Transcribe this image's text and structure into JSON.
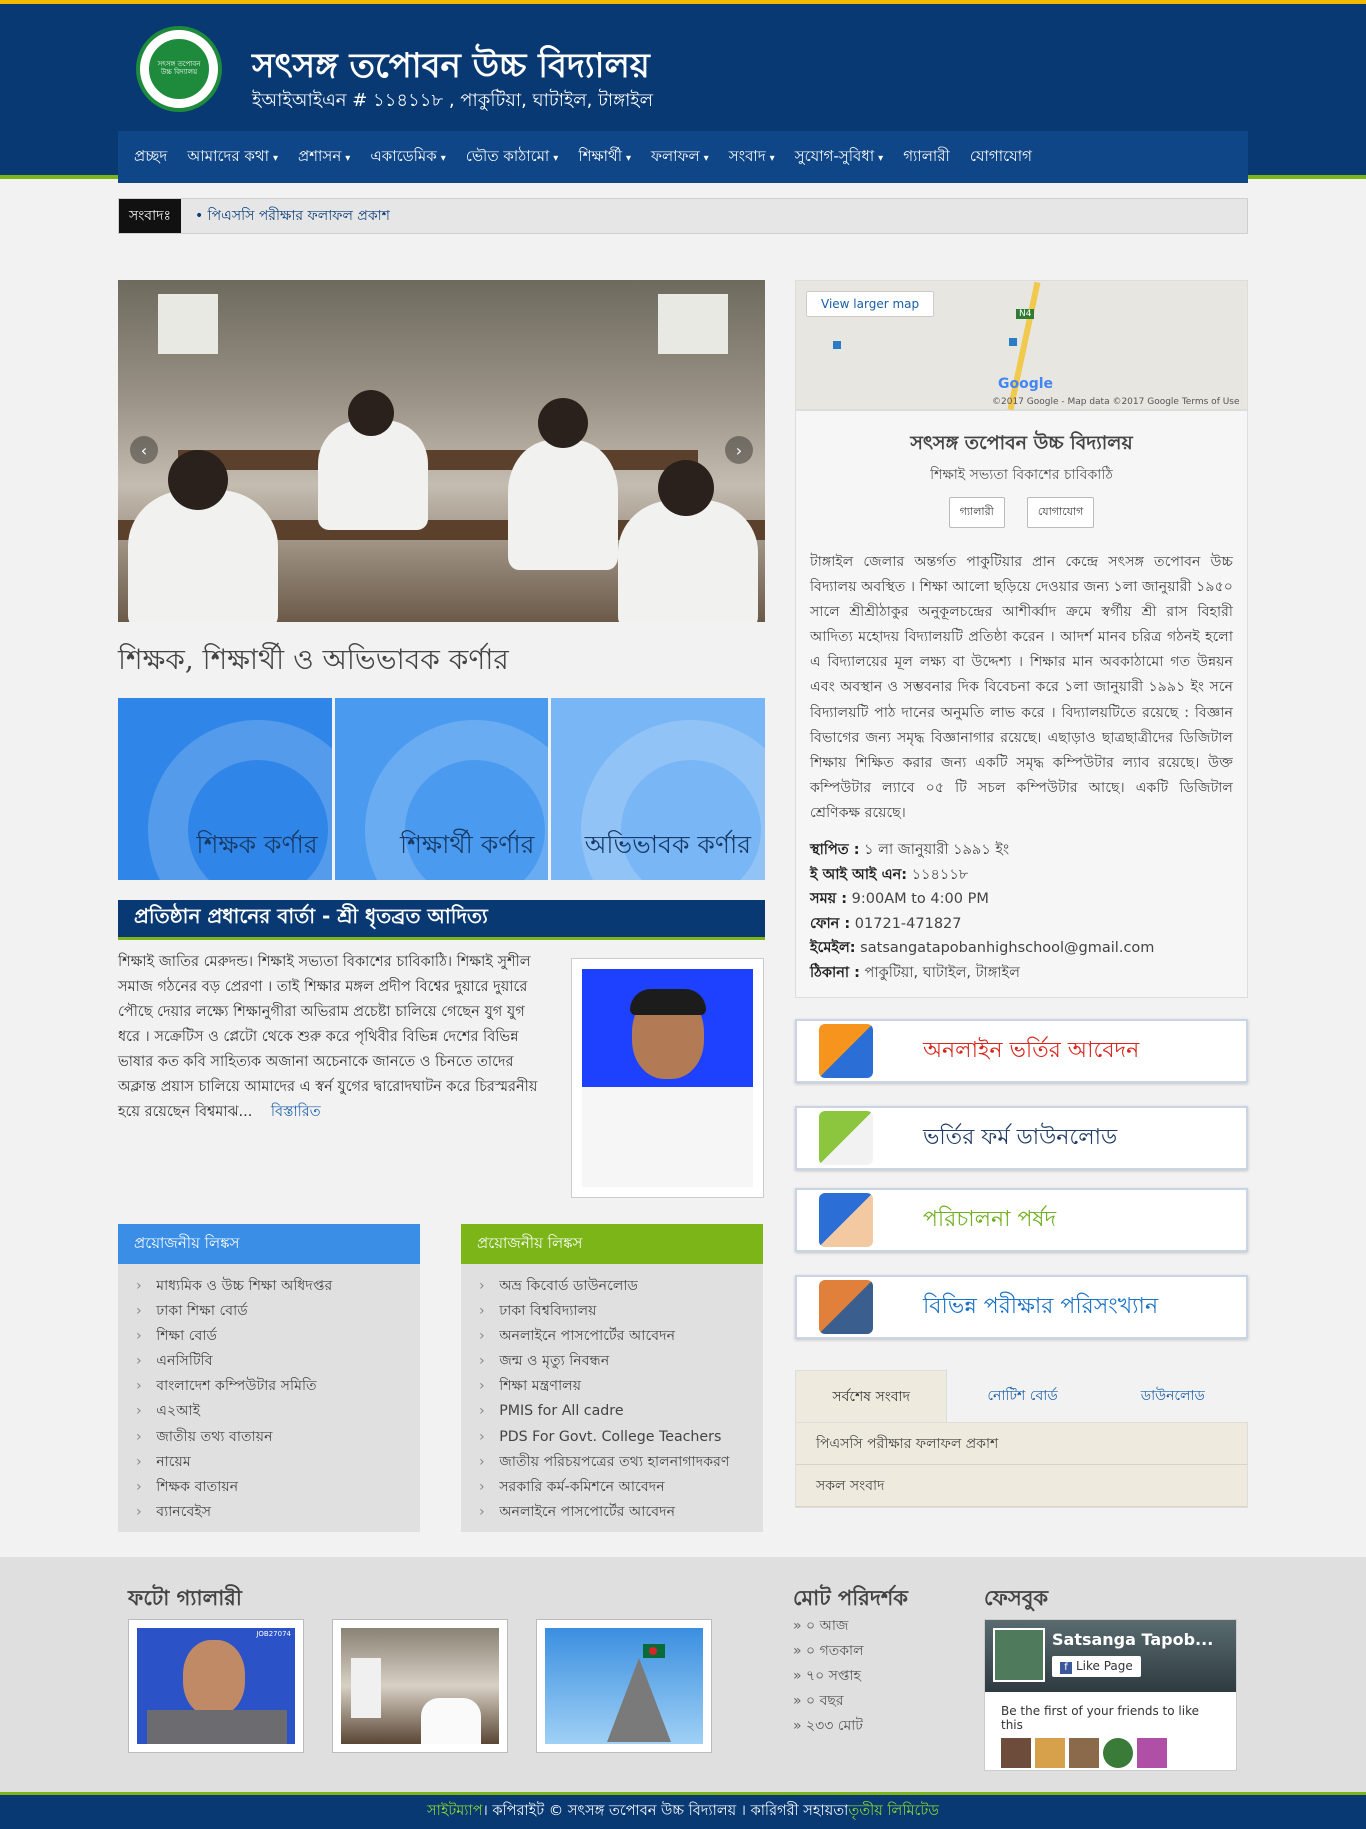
{
  "header": {
    "logo_text": "সৎসঙ্গ তপোবন উচ্চ বিদ্যালয়",
    "school_name": "সৎসঙ্গ তপোবন উচ্চ বিদ্যালয়",
    "school_sub": "ইআইআইএন # ১১৪১১৮ , পাকুটিয়া, ঘাটাইল, টাঙ্গাইল"
  },
  "nav": [
    {
      "label": "প্রচ্ছদ",
      "dropdown": false
    },
    {
      "label": "আমাদের কথা",
      "dropdown": true
    },
    {
      "label": "প্রশাসন",
      "dropdown": true
    },
    {
      "label": "একাডেমিক",
      "dropdown": true
    },
    {
      "label": "ভৌত কাঠামো",
      "dropdown": true
    },
    {
      "label": "শিক্ষার্থী",
      "dropdown": true
    },
    {
      "label": "ফলাফল",
      "dropdown": true
    },
    {
      "label": "সংবাদ",
      "dropdown": true
    },
    {
      "label": "সুযোগ-সুবিধা",
      "dropdown": true
    },
    {
      "label": "গ্যালারী",
      "dropdown": false
    },
    {
      "label": "যোগাযোগ",
      "dropdown": false
    }
  ],
  "news": {
    "label": "সংবাদঃ",
    "item": "পিএসসি পরীক্ষার ফলাফল প্রকাশ"
  },
  "corners": {
    "title": "শিক্ষক, শিক্ষার্থী ও অভিভাবক কর্ণার",
    "items": [
      {
        "label": "শিক্ষক কর্ণার",
        "color": "#2f86e8"
      },
      {
        "label": "শিক্ষার্থী কর্ণার",
        "color": "#4a9af0"
      },
      {
        "label": "অভিভাবক কর্ণার",
        "color": "#79b6f6"
      }
    ]
  },
  "head_message": {
    "title": "প্রতিষ্ঠান প্রধানের বার্তা - শ্রী ধৃতব্রত আদিত্য",
    "text": "শিক্ষাই জাতির মেরুদন্ড। শিক্ষাই সভ্যতা বিকাশের চাবিকাঠি। শিক্ষাই সুশীল সমাজ গঠনের বড় প্রেরণা । তাই শিক্ষার মঙ্গল প্রদীপ বিশ্বের দুয়ারে দুয়ারে পৌছে দেয়ার লক্ষ্যে শিক্ষানুগীরা অভিরাম প্রচেষ্টা চালিয়ে গেছেন যুগ যুগ ধরে । সক্রেটিস ও প্লেটো থেকে শুরু করে পৃথিবীর বিভিন্ন দেশের বিভিন্ন ভাষার কত কবি সাহিত্যক অজানা অচেনাকে জানতে ও চিনতে তাদের অক্লান্ত প্রয়াস চালিয়ে আমাদের এ স্বর্ন যুগের দ্বারোদঘাটন করে চিরস্মরনীয় হয়ে রয়েছেন বিশ্বমাঝ...",
    "more": "বিস্তারিত"
  },
  "links_left": {
    "title": "প্রয়োজনীয় লিঙ্কস",
    "color": "#3a8ee6",
    "items": [
      "মাধ্যমিক ও উচ্চ শিক্ষা অধিদপ্তর",
      "ঢাকা শিক্ষা বোর্ড",
      "শিক্ষা বোর্ড",
      "এনসিটিবি",
      "বাংলাদেশ কম্পিউটার সমিতি",
      "এ২আই",
      "জাতীয় তথ্য বাতায়ন",
      "নায়েম",
      "শিক্ষক বাতায়ন",
      "ব্যানবেইস"
    ]
  },
  "links_right": {
    "title": "প্রয়োজনীয় লিঙ্কস",
    "color": "#7cb518",
    "items": [
      "অভ্র কিবোর্ড ডাউনলোড",
      "ঢাকা বিশ্ববিদ্যালয়",
      "অনলাইনে পাসপোর্টের আবেদন",
      "জন্ম ও মৃত্যু নিবন্ধন",
      "শিক্ষা মন্ত্রণালয়",
      "PMIS for All cadre",
      "PDS For Govt. College Teachers",
      "জাতীয় পরিচয়পত্রের তথ্য হালনাগাদকরণ",
      "সরকারি কর্ম-কমিশনে আবেদন",
      "অনলাইনে পাসপোর্টের আবেদন"
    ]
  },
  "map": {
    "button": "View larger map",
    "brand": "Google",
    "road_label": "N4",
    "copyright": "©2017 Google - Map data ©2017 Google    Terms of Use"
  },
  "infobox": {
    "name": "সৎসঙ্গ তপোবন উচ্চ বিদ্যালয়",
    "slogan": "শিক্ষাই সভ্যতা বিকাশের চাবিকাঠি",
    "btn_gallery": "গ্যালারী",
    "btn_contact": "যোগাযোগ",
    "text": "টাঙ্গাইল জেলার অন্তর্গত পাকুটিয়ার প্রান কেন্দ্রে সৎসঙ্গ তপোবন উচ্চ বিদ্যালয় অবস্থিত । শিক্ষা আলো ছড়িয়ে দেওয়ার জন্য ১লা জানুয়ারী ১৯৫০ সালে শ্রীশ্রীঠাকুর অনুকূলচন্দ্রের আশীর্ব্বাদ ক্রমে স্বর্গীয় শ্রী রাস বিহারী আদিত্য মহোদয় বিদ্যালয়টি প্রতিষ্ঠা করেন । আদর্শ মানব চরিত্র গঠনই হলো এ বিদ্যালয়ের মূল লক্ষ্য বা উদ্দেশ্য । শিক্ষার মান অবকাঠামো গত উন্নয়ন এবং অবস্থান ও সম্ভবনার দিক বিবেচনা করে ১লা জানুয়ারী ১৯৯১ ইং সনে বিদ্যালয়টি পাঠ দানের অনুমতি লাভ করে । বিদ্যালয়টিতে রয়েছে : বিজ্ঞান বিভাগের জন্য সমৃদ্ধ বিজ্ঞানাগার রয়েছে। এছাড়াও ছাত্রছাত্রীদের ডিজিটাল শিক্ষায় শিক্ষিত করার জন্য একটি সমৃদ্ধ কম্পিউটার ল্যাব রয়েছে। উক্ত কম্পিউটার ল্যাবে ০৫ টি সচল কম্পিউটার আছে। একটি ডিজিটাল শ্রেণিকক্ষ রয়েছে।",
    "facts": [
      {
        "k": "স্থাপিত :",
        "v": " ১ লা জানুয়ারী ১৯৯১ ইং"
      },
      {
        "k": "ই আই আই এন:",
        "v": " ১১৪১১৮"
      },
      {
        "k": "সময় :",
        "v": " 9:00AM to 4:00 PM"
      },
      {
        "k": "ফোন :",
        "v": " 01721-471827"
      },
      {
        "k": "ইমেইল:",
        "v": " satsangatapobanhighschool@gmail.com"
      },
      {
        "k": "ঠিকানা :",
        "v": " পাকুটিয়া, ঘাটাইল, টাঙ্গাইল"
      }
    ]
  },
  "cta": [
    {
      "label": "অনলাইন ভর্তির আবেদন",
      "color": "#d9261c"
    },
    {
      "label": "ভর্তির ফর্ম ডাউনলোড",
      "color": "#1f3b66"
    },
    {
      "label": "পরিচালনা পর্ষদ",
      "color": "#6fae1c"
    },
    {
      "label": "বিভিন্ন পরীক্ষার পরিসংখ্যান",
      "color": "#1a73c6"
    }
  ],
  "tabs": {
    "labels": [
      "সর্বশেষ সংবাদ",
      "নোটিশ বোর্ড",
      "ডাউনলোড"
    ],
    "items": [
      "পিএসসি পরীক্ষার ফলাফল প্রকাশ",
      "সকল সংবাদ"
    ]
  },
  "footer": {
    "gallery_title": "ফটো গ্যালারী",
    "visitors_title": "মোট পরিদর্শক",
    "visitors": [
      "০ আজ",
      "০ গতকাল",
      "৭০ সপ্তাহ",
      "০ বছর",
      "২৩৩ মোট"
    ],
    "facebook_title": "ফেসবুক",
    "fb_name": "Satsanga Tapob...",
    "fb_like": "Like Page",
    "fb_first": "Be the first of your friends to like this",
    "thumb_code": "JOB27074"
  },
  "bottom": {
    "sitemap": "সাইটম্যাপ",
    "copyright": " । কপিরাইট © সৎসঙ্গ তপোবন উচ্চ বিদ্যালয় । কারিগরী সহায়তা ",
    "vendor": "তৃতীয় লিমিটেড"
  }
}
